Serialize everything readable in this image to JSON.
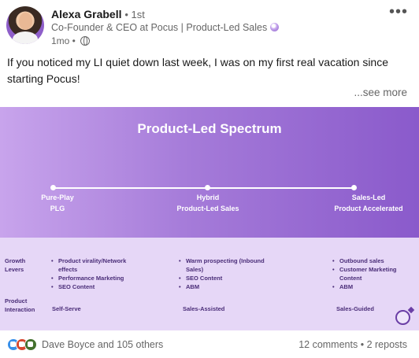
{
  "author": {
    "name": "Alexa Grabell",
    "degree": "• 1st",
    "headline": "Co-Founder & CEO at Pocus | Product-Led Sales",
    "time": "1mo •"
  },
  "menu": {
    "more_label": "•••"
  },
  "post": {
    "text": "If you noticed my LI quiet down last week, I was on my first real vacation since starting Pocus!",
    "see_more": "...see more"
  },
  "graphic": {
    "title": "Product-Led Spectrum",
    "spectrum": [
      {
        "line1": "Pure-Play",
        "line2": "PLG"
      },
      {
        "line1": "Hybrid",
        "line2": "Product-Led Sales"
      },
      {
        "line1": "Sales-Led",
        "line2": "Product Accelerated"
      }
    ],
    "rows": {
      "growth_label_1": "Growth",
      "growth_label_2": "Levers",
      "interaction_label_1": "Product",
      "interaction_label_2": "Interaction"
    },
    "columns": [
      {
        "levers": [
          "Product virality/Network",
          "effects",
          "Performance Marketing",
          "SEO Content"
        ],
        "interaction": "Self-Serve"
      },
      {
        "levers": [
          "Warm prospecting (Inbound",
          "Sales)",
          "SEO Content",
          "ABM"
        ],
        "interaction": "Sales-Assisted"
      },
      {
        "levers": [
          "Outbound sales",
          "Customer Marketing",
          "Content",
          "ABM"
        ],
        "interaction": "Sales-Guided"
      }
    ]
  },
  "social": {
    "reactions_text": "Dave Boyce and 105 others",
    "comments": "12 comments",
    "separator": "•",
    "reposts": "2 reposts"
  },
  "colors": {
    "accent_purple": "#8a5acb",
    "like_blue": "#378fe9",
    "celebrate_red": "#d7472f",
    "support_green": "#44712e"
  }
}
